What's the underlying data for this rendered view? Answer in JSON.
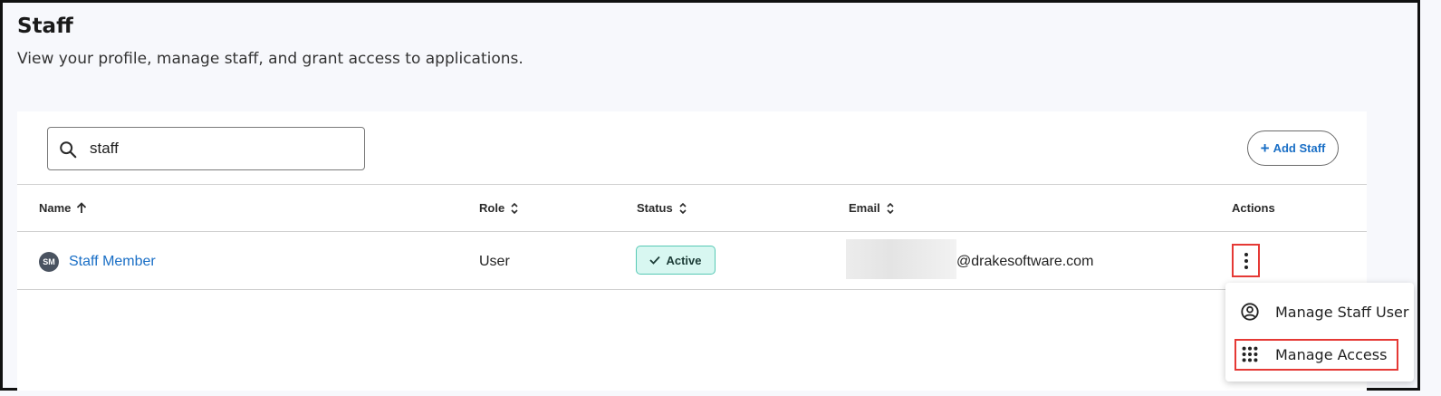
{
  "page": {
    "title": "Staff",
    "subtitle": "View your profile, manage staff, and grant access to applications."
  },
  "search": {
    "value": "staff",
    "icon": "search-icon"
  },
  "toolbar": {
    "add_staff_label": "Add Staff"
  },
  "table": {
    "columns": [
      {
        "label": "Name",
        "sort": "ascending"
      },
      {
        "label": "Role",
        "sort": "none"
      },
      {
        "label": "Status",
        "sort": "none"
      },
      {
        "label": "Email",
        "sort": "none"
      },
      {
        "label": "Actions",
        "sort": "none"
      }
    ],
    "rows": [
      {
        "initials": "SM",
        "name": "Staff Member",
        "role": "User",
        "status": "Active",
        "email_domain": "@drakesoftware.com"
      }
    ]
  },
  "actions_menu": {
    "items": [
      {
        "label": "Manage Staff User",
        "icon": "user-circle-icon"
      },
      {
        "label": "Manage Access",
        "icon": "app-grid-icon"
      }
    ]
  },
  "colors": {
    "link": "#1a6fc6",
    "status_bg": "#d8f7f1",
    "status_border": "#57c9b5",
    "highlight": "#e53935"
  }
}
